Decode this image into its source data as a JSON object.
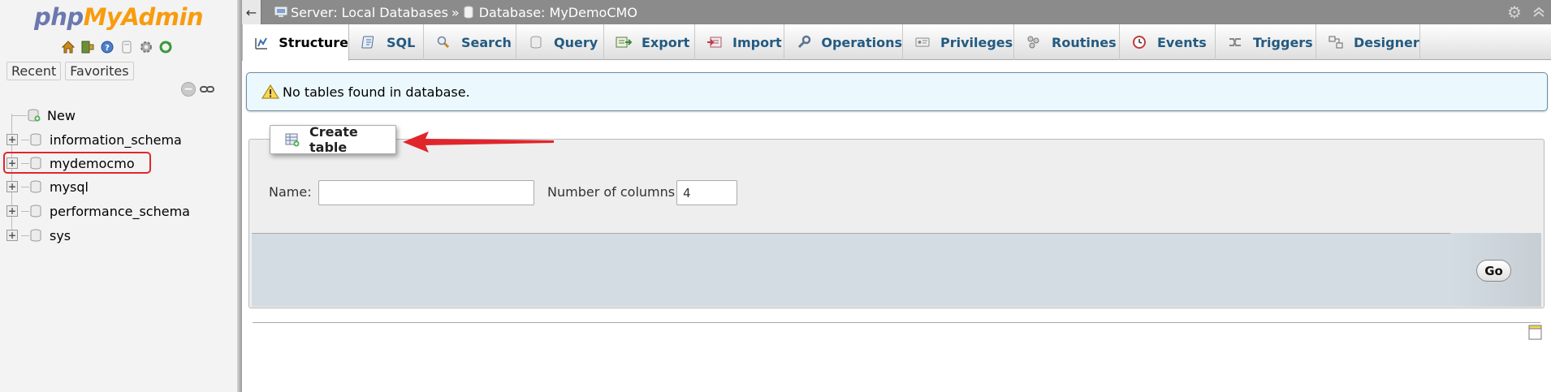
{
  "brand": {
    "part1": "php",
    "part2": "MyAdmin"
  },
  "nav": {
    "tabs": [
      {
        "label": "Recent"
      },
      {
        "label": "Favorites"
      }
    ],
    "tree": [
      {
        "label": "New"
      },
      {
        "label": "information_schema"
      },
      {
        "label": "mydemocmo"
      },
      {
        "label": "mysql"
      },
      {
        "label": "performance_schema"
      },
      {
        "label": "sys"
      }
    ],
    "expander_symbol": "+",
    "collapse_symbol": "−"
  },
  "topbar": {
    "back_symbol": "←",
    "server": "Server: Local Databases",
    "separator": "»",
    "database": "Database: MyDemoCMO"
  },
  "tabs": [
    {
      "label": "Structure",
      "icon": "structure-icon"
    },
    {
      "label": "SQL",
      "icon": "sql-icon"
    },
    {
      "label": "Search",
      "icon": "search-icon"
    },
    {
      "label": "Query",
      "icon": "query-icon"
    },
    {
      "label": "Export",
      "icon": "export-icon"
    },
    {
      "label": "Import",
      "icon": "import-icon"
    },
    {
      "label": "Operations",
      "icon": "wrench-icon"
    },
    {
      "label": "Privileges",
      "icon": "privileges-icon"
    },
    {
      "label": "Routines",
      "icon": "routines-icon"
    },
    {
      "label": "Events",
      "icon": "clock-icon"
    },
    {
      "label": "Triggers",
      "icon": "triggers-icon"
    },
    {
      "label": "Designer",
      "icon": "designer-icon"
    }
  ],
  "notice": {
    "text": "No tables found in database."
  },
  "create_table": {
    "legend": "Create table",
    "name_label": "Name:",
    "name_value": "",
    "columns_label": "Number of columns:",
    "columns_value": "4",
    "go_label": "Go"
  },
  "colors": {
    "tab_text": "#235a81",
    "topbar": "#8b8b8b",
    "notice_bg": "#ebf8fd",
    "highlight": "#e0262b",
    "arrow": "#e0262b",
    "footer_bg": "#d3dce3"
  }
}
